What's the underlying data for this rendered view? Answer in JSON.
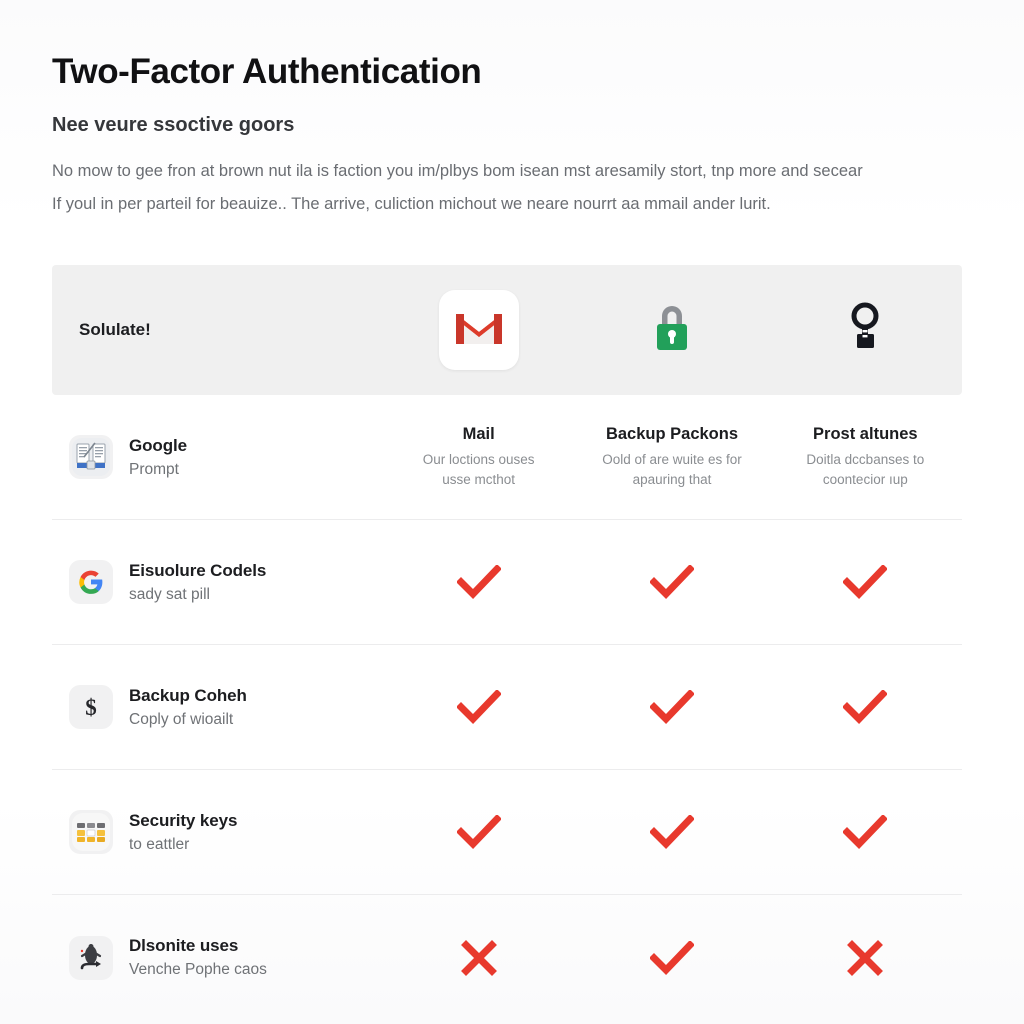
{
  "page": {
    "title": "Two-Factor Authentication",
    "subtitle": "Nee veure ssoctive goors",
    "intro_line1": "No mow to gee fron at brown nut ila is faction you im/plbys bom isean mst aresamily stort, tnp more and secear",
    "intro_line2": "If youl in per parteil for beauize.. The arrive, culiction michout we neare nourrt aa mmail ander lurit."
  },
  "colors": {
    "check": "#e8392d",
    "cross": "#e8392d",
    "lock_green": "#22a05a",
    "header_band": "#f0f0f0",
    "gmail_red": "#e0402f"
  },
  "brand_row": {
    "label": "Solulate!",
    "icons": [
      {
        "name": "gmail-icon",
        "alt": "Gmail"
      },
      {
        "name": "green-padlock-icon",
        "alt": "Padlock"
      },
      {
        "name": "security-key-icon",
        "alt": "Security key"
      }
    ]
  },
  "columns": [
    {
      "title": "Mail",
      "desc_line1": "Our loctions ouses",
      "desc_line2": "usse mcthot"
    },
    {
      "title": "Backup Packons",
      "desc_line1": "Oold of are wuite es for",
      "desc_line2": "apauring that"
    },
    {
      "title": "Prost altunes",
      "desc_line1": "Doitla dccbanses to",
      "desc_line2": "coontecior ıup"
    }
  ],
  "rows": [
    {
      "icon": "google-prompt-icon",
      "title": "Google",
      "subtitle": "Prompt",
      "is_header_row": true,
      "marks": []
    },
    {
      "icon": "google-g-icon",
      "title": "Eisuolure Codels",
      "subtitle": "sady sat pill",
      "is_header_row": false,
      "marks": [
        "check",
        "check",
        "check"
      ]
    },
    {
      "icon": "dollar-sign-icon",
      "title": "Backup Coheh",
      "subtitle": "Coply of wioailt",
      "is_header_row": false,
      "marks": [
        "check",
        "check",
        "check"
      ]
    },
    {
      "icon": "security-keys-icon",
      "title": "Security keys",
      "subtitle": "to eattler",
      "is_header_row": false,
      "marks": [
        "check",
        "check",
        "check"
      ]
    },
    {
      "icon": "device-arrow-icon",
      "title": "Dlsonite uses",
      "subtitle": "Venche Pophe caos",
      "is_header_row": false,
      "marks": [
        "cross",
        "check",
        "cross"
      ]
    }
  ]
}
